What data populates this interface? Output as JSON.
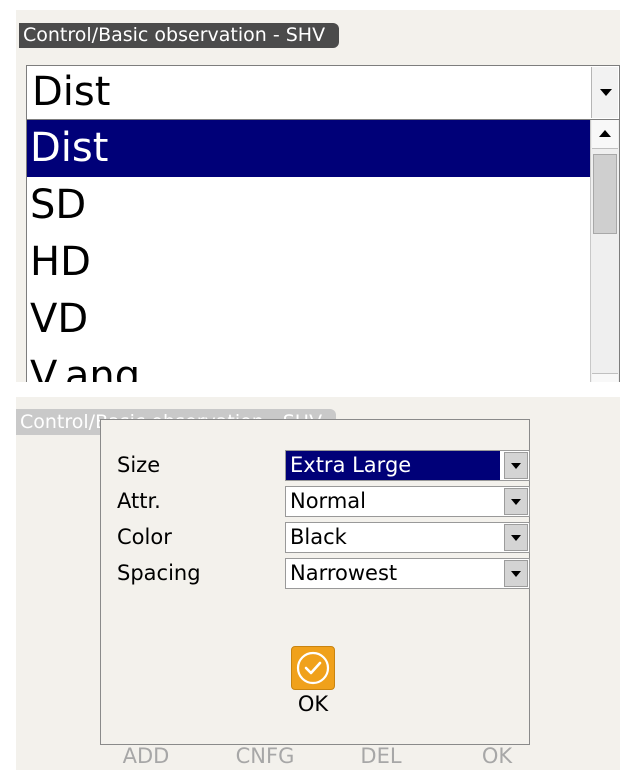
{
  "top_screen": {
    "title": "Control/Basic observation - SHV",
    "combo_value": "Dist",
    "list_items": [
      "Dist",
      "SD",
      "HD",
      "VD",
      "V.ang"
    ],
    "selected_index": 0
  },
  "bottom_screen": {
    "title": "Control/Basic observation - SHV",
    "dialog": {
      "rows": [
        {
          "label": "Size",
          "value": "Extra Large"
        },
        {
          "label": "Attr.",
          "value": "Normal"
        },
        {
          "label": "Color",
          "value": "Black"
        },
        {
          "label": "Spacing",
          "value": "Narrowest"
        }
      ],
      "ok_label": "OK"
    },
    "softkeys": [
      "ADD",
      "CNFG",
      "DEL",
      "OK"
    ]
  },
  "colors": {
    "selection": "#000078",
    "ok_icon": "#f0a11b",
    "title_tab": "#4b4b4b"
  }
}
